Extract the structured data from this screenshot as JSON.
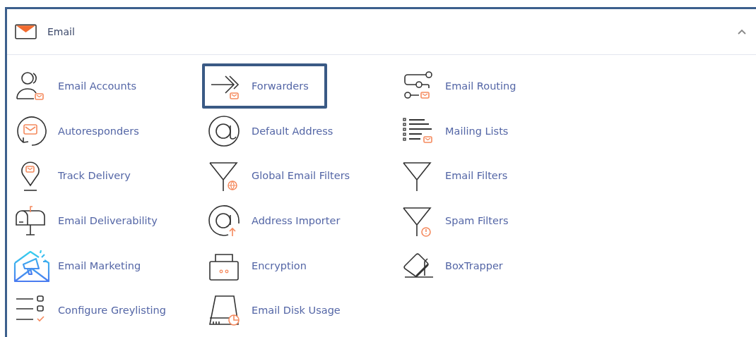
{
  "panel": {
    "title": "Email",
    "expanded": true,
    "items": [
      {
        "label": "Email Accounts",
        "kind": "user",
        "focused": false
      },
      {
        "label": "Forwarders",
        "kind": "forward",
        "focused": true
      },
      {
        "label": "Email Routing",
        "kind": "routing",
        "focused": false
      },
      {
        "label": "Autoresponders",
        "kind": "reply",
        "focused": false
      },
      {
        "label": "Default Address",
        "kind": "at",
        "focused": false
      },
      {
        "label": "Mailing Lists",
        "kind": "list",
        "focused": false
      },
      {
        "label": "Track Delivery",
        "kind": "pin",
        "focused": false
      },
      {
        "label": "Global Email Filters",
        "kind": "globefilter",
        "focused": false
      },
      {
        "label": "Email Filters",
        "kind": "filter",
        "focused": false
      },
      {
        "label": "Email Deliverability",
        "kind": "mailbox",
        "focused": false
      },
      {
        "label": "Address Importer",
        "kind": "import",
        "focused": false
      },
      {
        "label": "Spam Filters",
        "kind": "spam",
        "focused": false
      },
      {
        "label": "Email Marketing",
        "kind": "marketing",
        "focused": false
      },
      {
        "label": "Encryption",
        "kind": "lock",
        "focused": false
      },
      {
        "label": "BoxTrapper",
        "kind": "trap",
        "focused": false
      },
      {
        "label": "Configure Greylisting",
        "kind": "grey",
        "focused": false
      },
      {
        "label": "Email Disk Usage",
        "kind": "disk",
        "focused": false
      }
    ]
  }
}
